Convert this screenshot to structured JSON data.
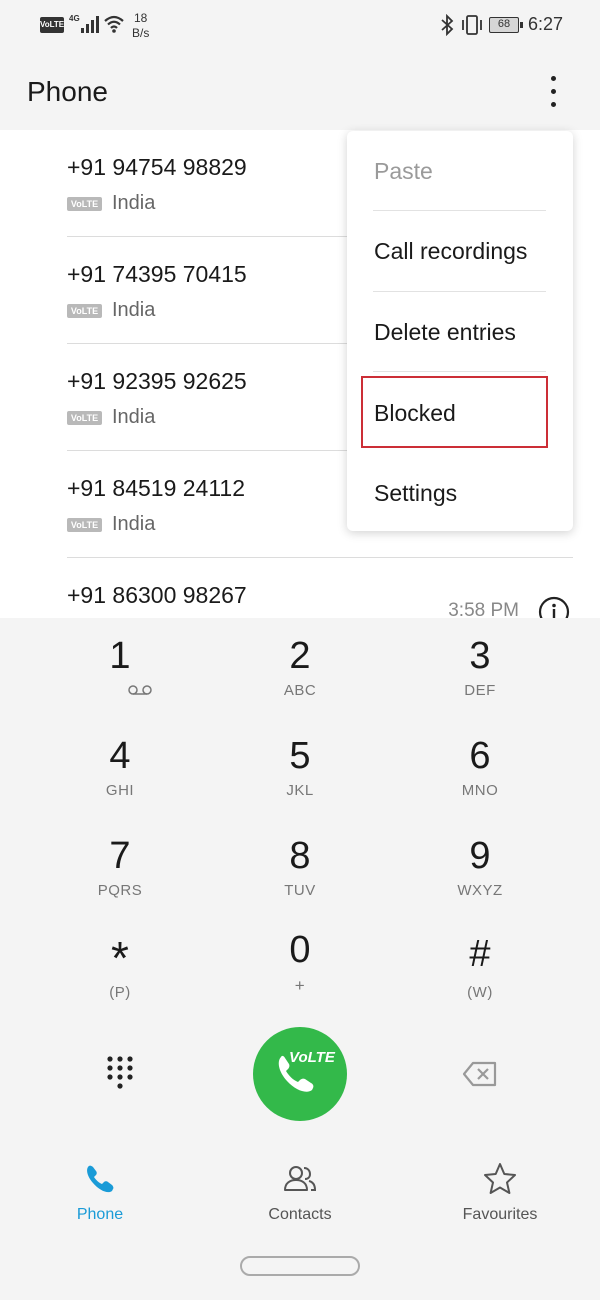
{
  "status_bar": {
    "volte": "VoLTE",
    "network": "4G",
    "speed_value": "18",
    "speed_unit": "B/s",
    "battery": "68",
    "time": "6:27"
  },
  "header": {
    "title": "Phone",
    "more_icon": "more-vertical-icon"
  },
  "call_log": [
    {
      "number": "+91 94754 98829",
      "badge": "VoLTE",
      "location": "India"
    },
    {
      "number": "+91 74395 70415",
      "badge": "VoLTE",
      "location": "India"
    },
    {
      "number": "+91 92395 92625",
      "badge": "VoLTE",
      "location": "India"
    },
    {
      "number": "+91 84519 24112",
      "badge": "VoLTE",
      "location": "India"
    },
    {
      "number": "+91 86300 98267",
      "time": "3:58 PM"
    }
  ],
  "menu": {
    "items": [
      {
        "label": "Paste",
        "enabled": false
      },
      {
        "label": "Call recordings",
        "enabled": true
      },
      {
        "label": "Delete entries",
        "enabled": true
      },
      {
        "label": "Blocked",
        "enabled": true,
        "highlighted": true
      },
      {
        "label": "Settings",
        "enabled": true
      }
    ],
    "highlight_color": "#cc2e36"
  },
  "dialpad": {
    "keys": [
      {
        "digit": "1",
        "letters": ""
      },
      {
        "digit": "2",
        "letters": "ABC"
      },
      {
        "digit": "3",
        "letters": "DEF"
      },
      {
        "digit": "4",
        "letters": "GHI"
      },
      {
        "digit": "5",
        "letters": "JKL"
      },
      {
        "digit": "6",
        "letters": "MNO"
      },
      {
        "digit": "7",
        "letters": "PQRS"
      },
      {
        "digit": "8",
        "letters": "TUV"
      },
      {
        "digit": "9",
        "letters": "WXYZ"
      },
      {
        "digit": "*",
        "letters": "(P)"
      },
      {
        "digit": "0",
        "letters": "+"
      },
      {
        "digit": "#",
        "letters": "(W)"
      }
    ],
    "call_button_label": "VoLTE",
    "call_color": "#33b94a"
  },
  "bottom_nav": {
    "items": [
      {
        "label": "Phone",
        "icon": "phone-icon",
        "active": true
      },
      {
        "label": "Contacts",
        "icon": "contacts-icon",
        "active": false
      },
      {
        "label": "Favourites",
        "icon": "star-icon",
        "active": false
      }
    ],
    "active_color": "#1a9bd7"
  }
}
